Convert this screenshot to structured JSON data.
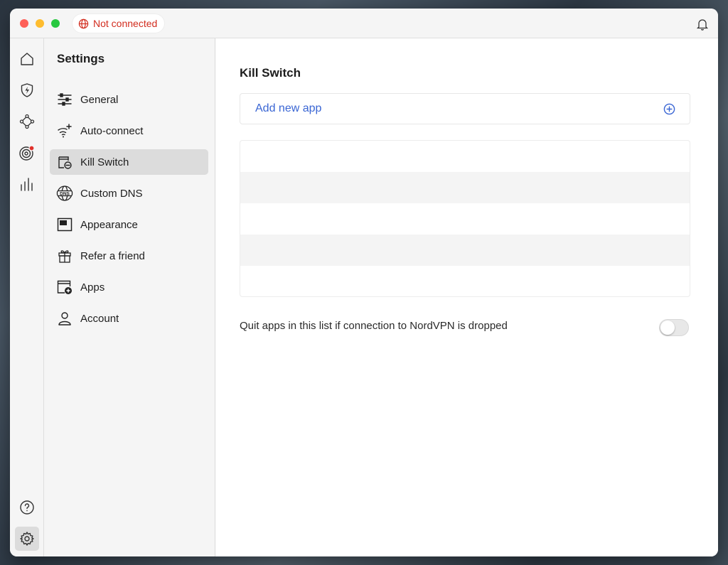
{
  "titlebar": {
    "status_text": "Not connected",
    "status_color": "#d22c1e",
    "status_icon": "globe-icon",
    "notification_icon": "bell-icon"
  },
  "rail": {
    "items": [
      {
        "name": "home",
        "icon": "home-icon"
      },
      {
        "name": "threat-protection",
        "icon": "shield-bolt-icon"
      },
      {
        "name": "meshnet",
        "icon": "mesh-nodes-icon"
      },
      {
        "name": "dark-web-monitor",
        "icon": "target-icon",
        "badge": true
      },
      {
        "name": "statistics",
        "icon": "bar-chart-icon"
      },
      {
        "name": "help",
        "icon": "question-icon"
      },
      {
        "name": "settings",
        "icon": "gear-icon",
        "active": true
      }
    ]
  },
  "sidebar": {
    "title": "Settings",
    "items": [
      {
        "label": "General",
        "icon": "sliders-icon"
      },
      {
        "label": "Auto-connect",
        "icon": "wifi-sparkle-icon"
      },
      {
        "label": "Kill Switch",
        "icon": "kill-switch-icon",
        "active": true
      },
      {
        "label": "Custom DNS",
        "icon": "dns-globe-icon"
      },
      {
        "label": "Appearance",
        "icon": "window-icon"
      },
      {
        "label": "Refer a friend",
        "icon": "gift-icon"
      },
      {
        "label": "Apps",
        "icon": "add-app-icon"
      },
      {
        "label": "Account",
        "icon": "person-icon"
      }
    ]
  },
  "main": {
    "title": "Kill Switch",
    "add_app_label": "Add new app",
    "add_app_icon": "plus-circle-icon",
    "accent_color": "#3a66d4",
    "quit_label": "Quit apps in this list if connection to NordVPN is dropped",
    "quit_toggle_on": false
  }
}
